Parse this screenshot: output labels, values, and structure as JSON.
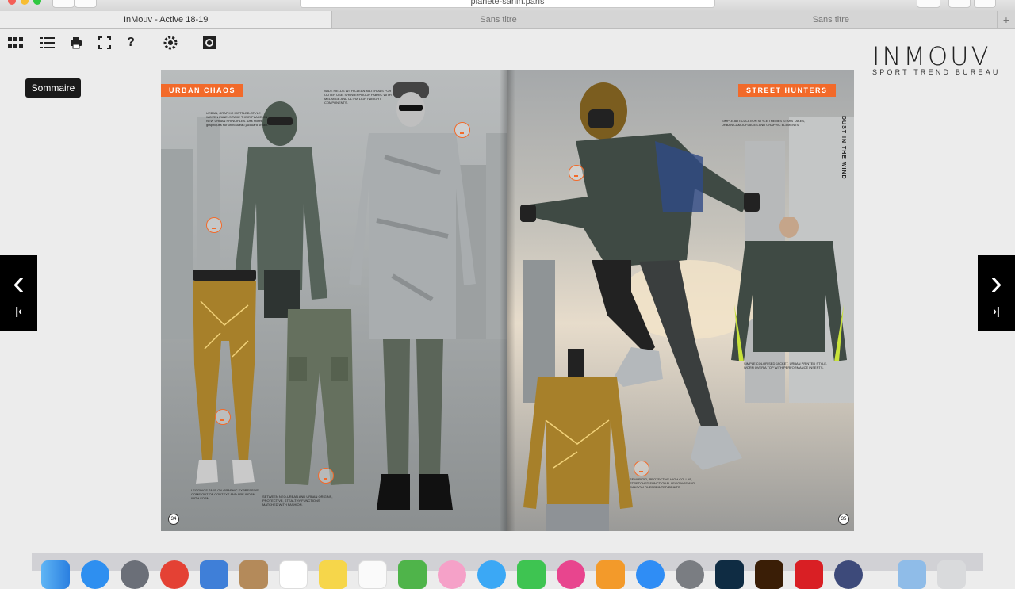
{
  "browser": {
    "url": "planete-sanin.paris",
    "tabs": [
      "InMouv - Active 18-19",
      "Sans titre",
      "Sans titre"
    ],
    "new_tab": "+"
  },
  "toolbar": {
    "icons": [
      "grid-icon",
      "list-icon",
      "print-icon",
      "fullscreen-icon",
      "help-icon",
      "settings-icon",
      "gallery-icon"
    ],
    "help_label": "?",
    "tooltip": "Sommaire"
  },
  "logo": {
    "main": "INMOUV",
    "sub": "SPORT TREND BUREAU"
  },
  "spread": {
    "left_tag": "URBAN CHAOS",
    "right_tag": "STREET HUNTERS",
    "right_vertical": "DUST IN THE WIND",
    "left_page_num": "34",
    "right_page_num": "35",
    "captions": [
      "URBAN, GRAPHIC MOTTLED-STYLE WOVEN PANELS TAKE THEIR PLACE ON NEW URBAN PRINCIPLES. Des motifs graphiques sur un nouveau jacquard urbain.",
      "WIDE FIELDS WITH CLEAN MATERIALS FOR OUTER USE. SHOWERPROOF FABRIC WITH MELANGE AND ULTRA LIGHTWEIGHT COMPONENTS.",
      "LEGGINGS TAKE ON GRAPHIC EXPRESSIVE, COME OUT OF CONTEXT AND ARE WORN WITH FORM.",
      "SETWEEN NEO-URBAN AND URBAN ORIGINS, PROTECTIVE, STEALTHY FUNCTIONS MATCHED WITH FASHION.",
      "SIMPLE ARTICULATION STYLE THEMES STARS TAKES, URBAN CAMOUFLAGES AND GRAPHIC ELEMENTS.",
      "SIMPLE COLORISED JACKET, URBAN PRINTED STYLE, WORN OVER A TOP WITH PERFORMANCE INSERTS.",
      "SEMI-RIGID, PROTECTIVE HIGH COLLAR, STRETCHED FUNCTIONAL LEGGINGS AND RANDOM OVERPRINTED PRINTS."
    ]
  },
  "nav": {
    "prev_label": "‹",
    "first_label": "|‹",
    "next_label": "›",
    "last_label": "›|"
  },
  "colors": {
    "accent": "#f26a2a",
    "nav": "#000000",
    "tooltip": "#1a1a1a"
  }
}
